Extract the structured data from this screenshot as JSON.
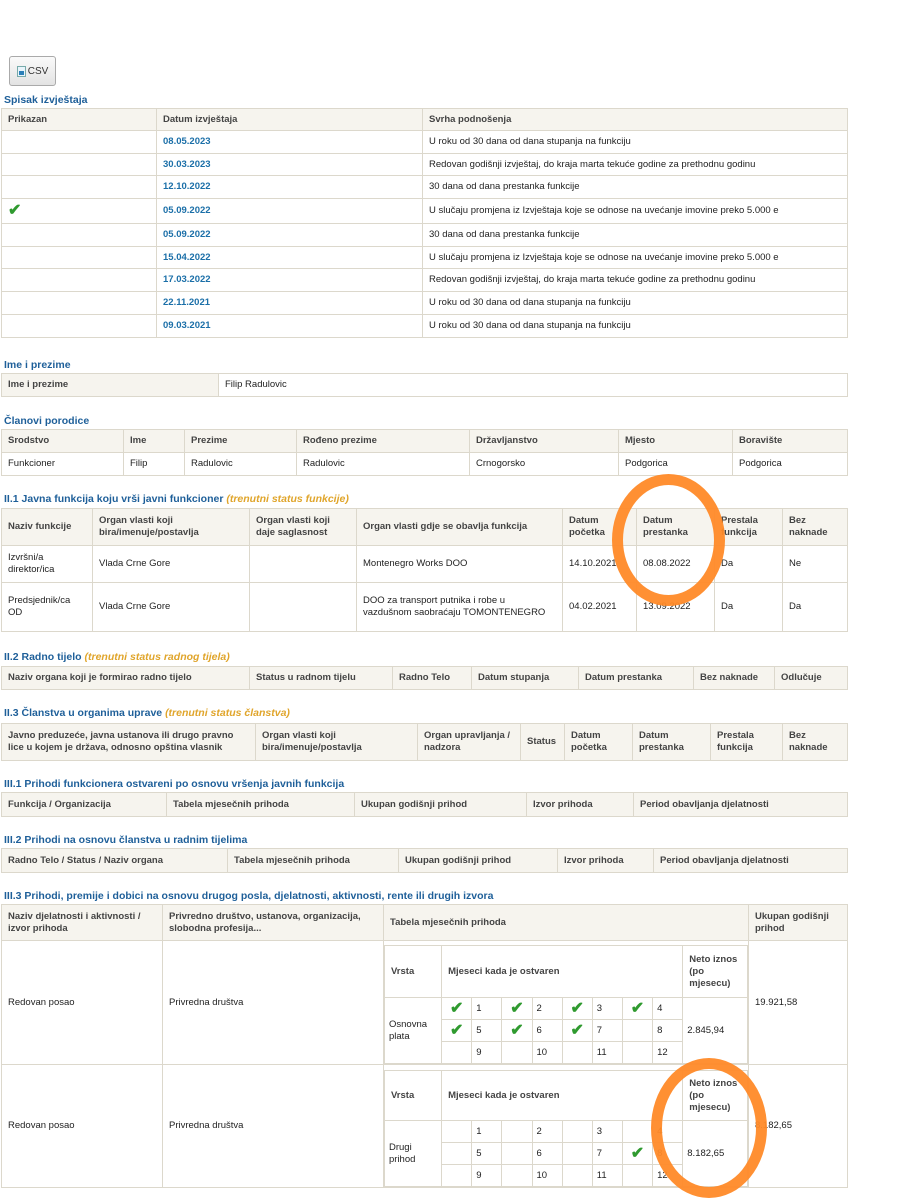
{
  "toolbar": {
    "csv_label": "CSV"
  },
  "spisak": {
    "title": "Spisak izvještaja",
    "headers": [
      "Prikazan",
      "Datum izvještaja",
      "Svrha podnošenja"
    ],
    "rows": [
      {
        "shown": false,
        "date": "08.05.2023",
        "purpose": "U roku od 30 dana od dana stupanja na funkciju"
      },
      {
        "shown": false,
        "date": "30.03.2023",
        "purpose": "Redovan godišnji izvještaj, do kraja marta tekuće godine za prethodnu godinu"
      },
      {
        "shown": false,
        "date": "12.10.2022",
        "purpose": "30 dana od dana prestanka funkcije"
      },
      {
        "shown": true,
        "date": "05.09.2022",
        "purpose": "U slučaju promjena iz Izvještaja koje se odnose na uvećanje imovine preko 5.000 e"
      },
      {
        "shown": false,
        "date": "05.09.2022",
        "purpose": "30 dana od dana prestanka funkcije"
      },
      {
        "shown": false,
        "date": "15.04.2022",
        "purpose": "U slučaju promjena iz Izvještaja koje se odnose na uvećanje imovine preko 5.000 e"
      },
      {
        "shown": false,
        "date": "17.03.2022",
        "purpose": "Redovan godišnji izvještaj, do kraja marta tekuće godine za prethodnu godinu"
      },
      {
        "shown": false,
        "date": "22.11.2021",
        "purpose": "U roku od 30 dana od dana stupanja na funkciju"
      },
      {
        "shown": false,
        "date": "09.03.2021",
        "purpose": "U roku od 30 dana od dana stupanja na funkciju"
      }
    ]
  },
  "ime": {
    "title": "Ime i prezime",
    "label": "Ime i prezime",
    "value": "Filip Radulovic"
  },
  "clanovi": {
    "title": "Članovi porodice",
    "headers": [
      "Srodstvo",
      "Ime",
      "Prezime",
      "Rođeno prezime",
      "Državljanstvo",
      "Mjesto",
      "Boravište"
    ],
    "row": [
      "Funkcioner",
      "Filip",
      "Radulovic",
      "Radulovic",
      "Crnogorsko",
      "Podgorica",
      "Podgorica"
    ]
  },
  "javna": {
    "title": "II.1 Javna funkcija koju vrši javni funkcioner",
    "note": "(trenutni status funkcije)",
    "headers": [
      "Naziv funkcije",
      "Organ vlasti koji bira/imenuje/postavlja",
      "Organ vlasti koji daje saglasnost",
      "Organ vlasti gdje se obavlja funkcija",
      "Datum početka",
      "Datum prestanka",
      "Prestala funkcija",
      "Bez naknade"
    ],
    "rows": [
      [
        "Izvršni/a direktor/ica",
        "Vlada Crne Gore",
        "",
        "Montenegro Works DOO",
        "14.10.2021",
        "08.08.2022",
        "Da",
        "Ne"
      ],
      [
        "Predsjednik/ca OD",
        "Vlada Crne Gore",
        "",
        "DOO za transport putnika i robe u vazdušnom saobraćaju TOMONTENEGRO",
        "04.02.2021",
        "13.09.2022",
        "Da",
        "Da"
      ]
    ]
  },
  "radno": {
    "title": "II.2 Radno tijelo",
    "note": "(trenutni status radnog tijela)",
    "headers": [
      "Naziv organa koji je formirao radno tijelo",
      "Status u radnom tijelu",
      "Radno Telo",
      "Datum stupanja",
      "Datum prestanka",
      "Bez naknade",
      "Odlučuje"
    ]
  },
  "clanstvo": {
    "title": "II.3 Članstva u organima uprave",
    "note": "(trenutni status članstva)",
    "headers": [
      "Javno preduzeće, javna ustanova ili drugo pravno lice u kojem je država, odnosno opština vlasnik",
      "Organ vlasti koji bira/imenuje/postavlja",
      "Organ upravljanja / nadzora",
      "Status",
      "Datum početka",
      "Datum prestanka",
      "Prestala funkcija",
      "Bez naknade"
    ]
  },
  "prihodi1": {
    "title": "III.1 Prihodi funkcionera ostvareni po osnovu vršenja javnih funkcija",
    "headers": [
      "Funkcija / Organizacija",
      "Tabela mjesečnih prihoda",
      "Ukupan godišnji prihod",
      "Izvor prihoda",
      "Period obavljanja djelatnosti"
    ]
  },
  "prihodi2": {
    "title": "III.2 Prihodi na osnovu članstva u radnim tijelima",
    "headers": [
      "Radno Telo / Status / Naziv organa",
      "Tabela mjesečnih prihoda",
      "Ukupan godišnji prihod",
      "Izvor prihoda",
      "Period obavljanja djelatnosti"
    ]
  },
  "prihodi3": {
    "title": "III.3 Prihodi, premije i dobici na osnovu drugog posla, djelatnosti, aktivnosti, rente ili drugih izvora",
    "headers": [
      "Naziv djelatnosti i aktivnosti / izvor prihoda",
      "Privredno društvo, ustanova, organizacija, slobodna profesija...",
      "Tabela mjesečnih prihoda",
      "Ukupan godišnji prihod"
    ],
    "inner_headers": [
      "Vrsta",
      "Mjeseci kada je ostvaren",
      "Neto iznos (po mjesecu)"
    ],
    "rows": [
      {
        "activity": "Redovan posao",
        "entity": "Privredna društva",
        "vrsta": "Osnovna plata",
        "neto": "2.845,94",
        "total": "19.921,58",
        "months": [
          1,
          2,
          3,
          4,
          5,
          6,
          7,
          8,
          9,
          10,
          11,
          12
        ],
        "checked": [
          1,
          2,
          3,
          4,
          5,
          6,
          7
        ]
      },
      {
        "activity": "Redovan posao",
        "entity": "Privredna društva",
        "vrsta": "Drugi prihod",
        "neto": "8.182,65",
        "total": "8.182,65",
        "months": [
          1,
          2,
          3,
          4,
          5,
          6,
          7,
          8,
          9,
          10,
          11,
          12
        ],
        "checked": [
          8
        ]
      }
    ]
  }
}
